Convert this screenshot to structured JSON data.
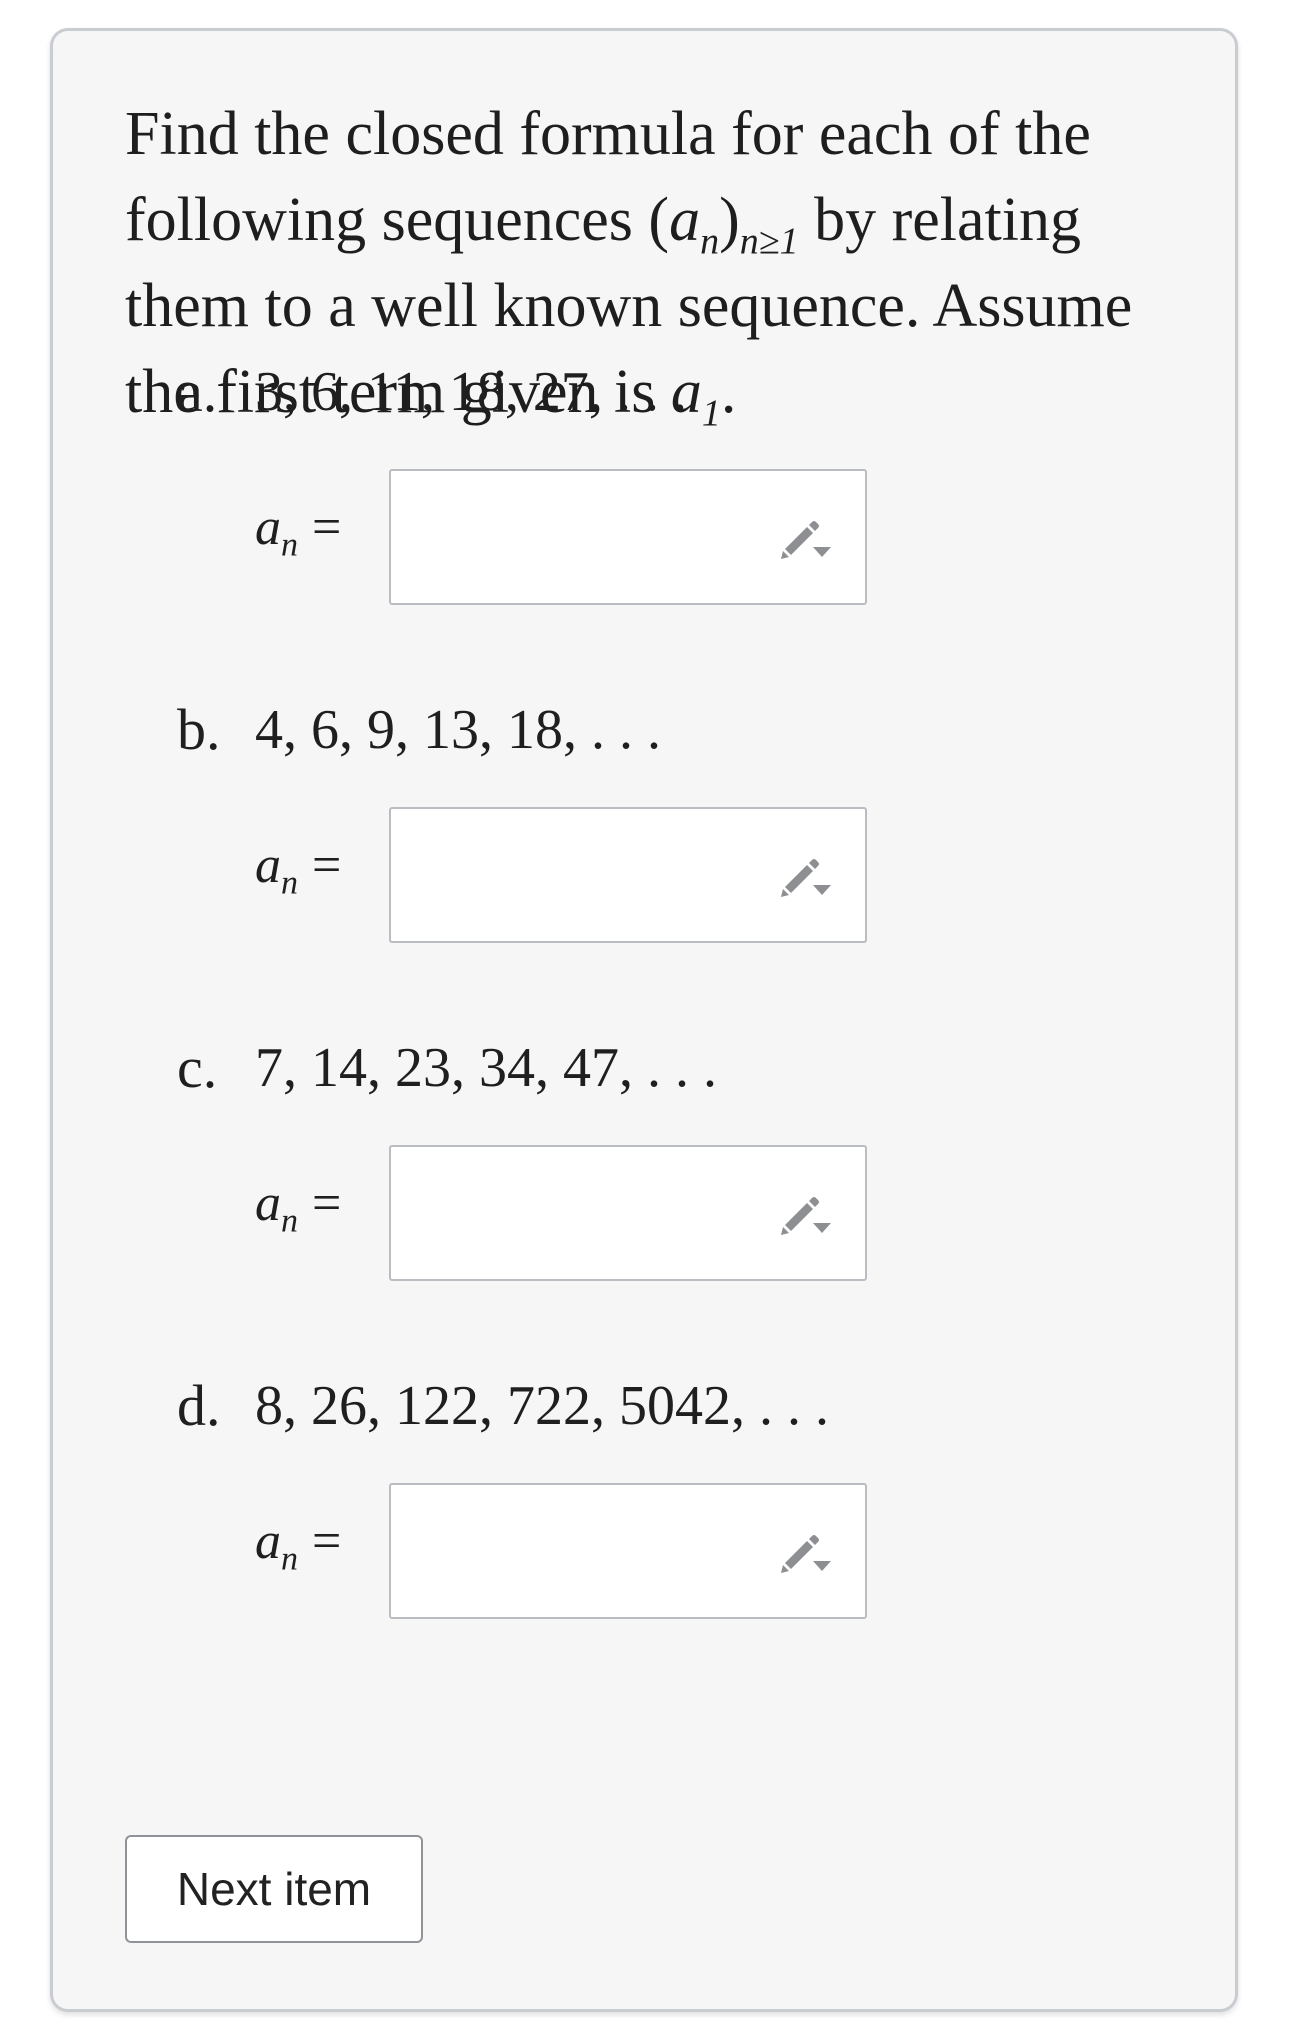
{
  "prompt": {
    "line1": "Find the closed formula for each of the",
    "line2_pre": "following sequences (",
    "line2_math_a": "a",
    "line2_math_sub_n": "n",
    "line2_close": ")",
    "line2_math_sub_cond": "n≥1",
    "line2_post": " by relating",
    "line3": "them to a well known sequence. Assume",
    "line4_pre": "the first term given is ",
    "line4_math_a": "a",
    "line4_math_sub": "1",
    "line4_post": "."
  },
  "problems": [
    {
      "label": "a.",
      "sequence": "3, 6, 11, 18, 27, . . .",
      "answer_var": "a",
      "answer_sub": "n",
      "answer_eq": "=",
      "answer_value": ""
    },
    {
      "label": "b.",
      "sequence": "4, 6, 9, 13, 18, . . .",
      "answer_var": "a",
      "answer_sub": "n",
      "answer_eq": "=",
      "answer_value": ""
    },
    {
      "label": "c.",
      "sequence": "7, 14, 23, 34, 47, . . .",
      "answer_var": "a",
      "answer_sub": "n",
      "answer_eq": "=",
      "answer_value": ""
    },
    {
      "label": "d.",
      "sequence": "8, 26, 122, 722, 5042, . . .",
      "answer_var": "a",
      "answer_sub": "n",
      "answer_eq": "=",
      "answer_value": ""
    }
  ],
  "icons": {
    "answer_tool": "pencil-dropdown-icon"
  },
  "next_button": {
    "label": "Next item"
  },
  "colors": {
    "card_background": "#f6f6f7",
    "card_border": "#c9cdd2",
    "icon_gray": "#8d8f92"
  }
}
